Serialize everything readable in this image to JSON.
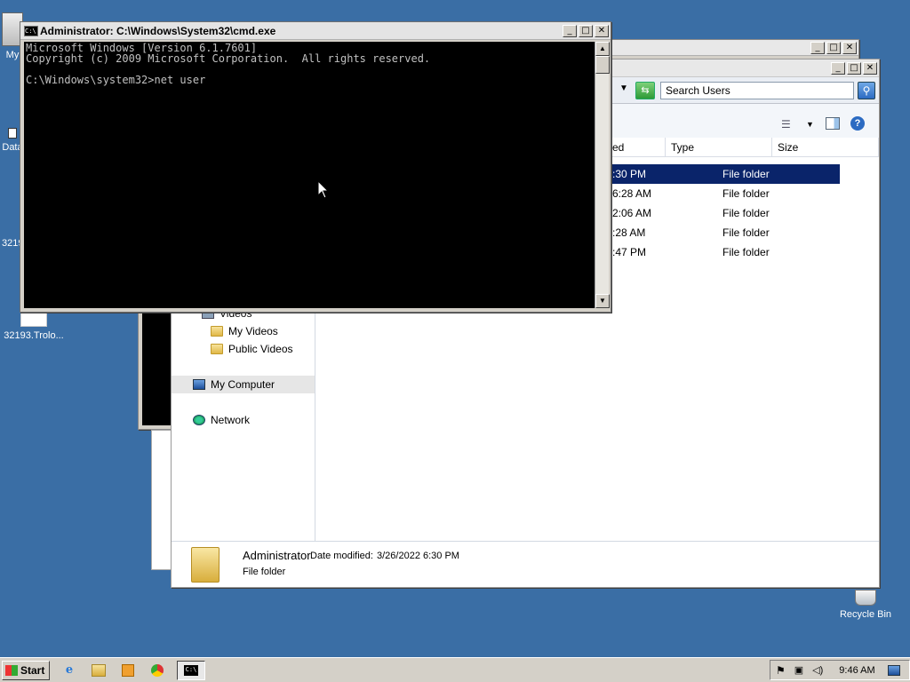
{
  "desktop": {
    "icons": [
      {
        "label": "My",
        "name": "my-computer"
      },
      {
        "label": "Data",
        "name": "data"
      },
      {
        "label": "3219",
        "name": "file-3219"
      },
      {
        "label": "32193.Trolo...",
        "name": "file-32193"
      },
      {
        "label": "Recycle Bin",
        "name": "recycle-bin"
      }
    ]
  },
  "cmd": {
    "title": "Administrator: C:\\Windows\\System32\\cmd.exe",
    "lines": [
      "Microsoft Windows [Version 6.1.7601]",
      "Copyright (c) 2009 Microsoft Corporation.  All rights reserved.",
      "",
      "C:\\Windows\\system32>net user"
    ]
  },
  "explorer": {
    "search_placeholder": "Search Users",
    "columns": [
      "ed",
      "Type",
      "Size"
    ],
    "rows": [
      {
        "modified": ":30 PM",
        "type": "File folder"
      },
      {
        "modified": "6:28 AM",
        "type": "File folder"
      },
      {
        "modified": "2:06 AM",
        "type": "File folder"
      },
      {
        "modified": ":28 AM",
        "type": "File folder"
      },
      {
        "modified": ":47 PM",
        "type": "File folder"
      }
    ],
    "nav": [
      {
        "label": "Videos",
        "kind": "library",
        "indent": 1
      },
      {
        "label": "My Videos",
        "kind": "folder",
        "indent": 2
      },
      {
        "label": "Public Videos",
        "kind": "folder",
        "indent": 2
      },
      {
        "label": "My Computer",
        "kind": "computer",
        "indent": 1
      },
      {
        "label": "Network",
        "kind": "network",
        "indent": 1
      }
    ],
    "status": {
      "name": "Administrator",
      "date_label": "Date modified:",
      "date_value": "3/26/2022 6:30 PM",
      "type": "File folder"
    }
  },
  "taskbar": {
    "start_label": "Start",
    "clock": "9:46 AM"
  }
}
